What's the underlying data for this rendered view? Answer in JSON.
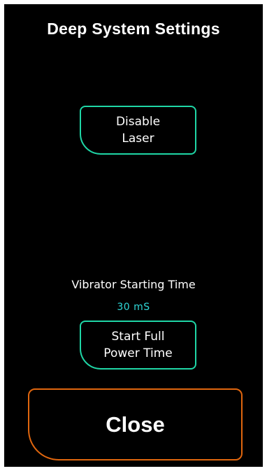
{
  "header": {
    "title": "Deep System Settings"
  },
  "buttons": {
    "disable_laser": "Disable\nLaser",
    "start_full_power_time": "Start Full\nPower Time",
    "close": "Close"
  },
  "vibrator": {
    "label": "Vibrator Starting Time",
    "value": "30 mS"
  },
  "colors": {
    "background": "#000000",
    "button_border_accent": "#1fd6a6",
    "close_border": "#e0660e",
    "value_text": "#2fd8d8",
    "text": "#ffffff"
  }
}
